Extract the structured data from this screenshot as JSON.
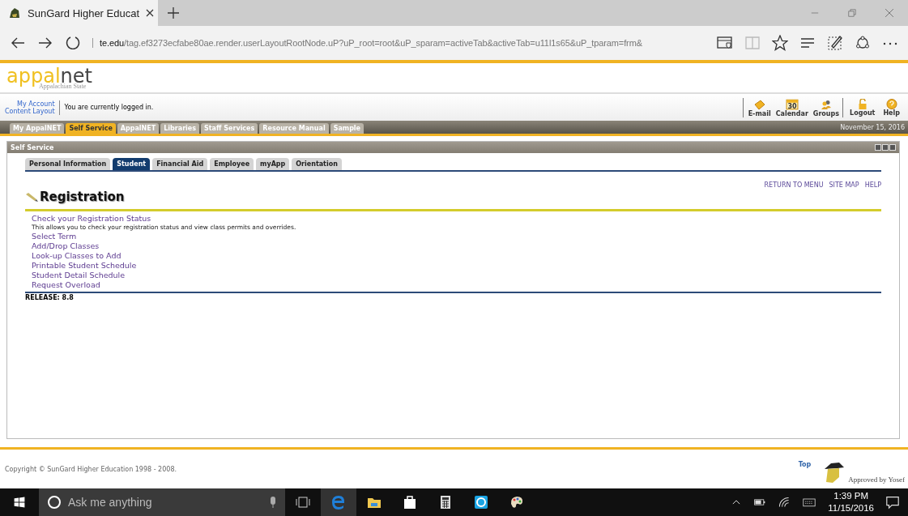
{
  "browser": {
    "tabs": [
      {
        "title": "SunGard Higher Educat",
        "selected": true
      }
    ],
    "address": {
      "host": "te.edu",
      "path": "/tag.ef3273ecfabe80ae.render.userLayoutRootNode.uP?uP_root=root&uP_sparam=activeTab&activeTab=u11l1s65&uP_tparam=frm&"
    }
  },
  "header": {
    "logo_left": "appal",
    "logo_right": "net",
    "logo_sub": "Appalachian State",
    "account_links": [
      "My Account",
      "Content Layout"
    ],
    "login_status": "You are currently logged in.",
    "tools": [
      {
        "label": "E-mail",
        "kind": "email"
      },
      {
        "label": "Calendar",
        "kind": "calendar",
        "badge": "30"
      },
      {
        "label": "Groups",
        "kind": "groups"
      },
      {
        "label": "Logout",
        "kind": "logout"
      },
      {
        "label": "Help",
        "kind": "help"
      }
    ]
  },
  "nav_tabs": [
    {
      "label": "My AppalNET",
      "selected": false
    },
    {
      "label": "Self Service",
      "selected": true
    },
    {
      "label": "AppalNET",
      "selected": false
    },
    {
      "label": "Libraries",
      "selected": false
    },
    {
      "label": "Staff Services",
      "selected": false
    },
    {
      "label": "Resource Manual",
      "selected": false
    },
    {
      "label": "Sample",
      "selected": false
    }
  ],
  "date": "November 15, 2016",
  "channel": {
    "title": "Self Service",
    "tabs": [
      {
        "label": "Personal Information",
        "selected": false
      },
      {
        "label": "Student",
        "selected": true
      },
      {
        "label": "Financial Aid",
        "selected": false
      },
      {
        "label": "Employee",
        "selected": false
      },
      {
        "label": "myApp",
        "selected": false
      },
      {
        "label": "Orientation",
        "selected": false
      }
    ],
    "top_links": [
      "RETURN TO MENU",
      "SITE MAP",
      "HELP"
    ],
    "heading": "Registration",
    "menu": [
      {
        "label": "Check your Registration Status",
        "description": "This allows you to check your registration status and view class permits and overrides."
      },
      {
        "label": "Select Term"
      },
      {
        "label": "Add/Drop Classes"
      },
      {
        "label": "Look-up Classes to Add"
      },
      {
        "label": "Printable Student Schedule"
      },
      {
        "label": "Student Detail Schedule"
      },
      {
        "label": "Request Overload"
      }
    ],
    "release": "RELEASE: 8.8"
  },
  "footer": {
    "copyright": "Copyright © SunGard Higher Education 1998 - 2008.",
    "top_link": "Top",
    "approved": "Approved by Yosef"
  },
  "taskbar": {
    "search_placeholder": "Ask me anything",
    "time": "1:39 PM",
    "date": "11/15/2016"
  }
}
